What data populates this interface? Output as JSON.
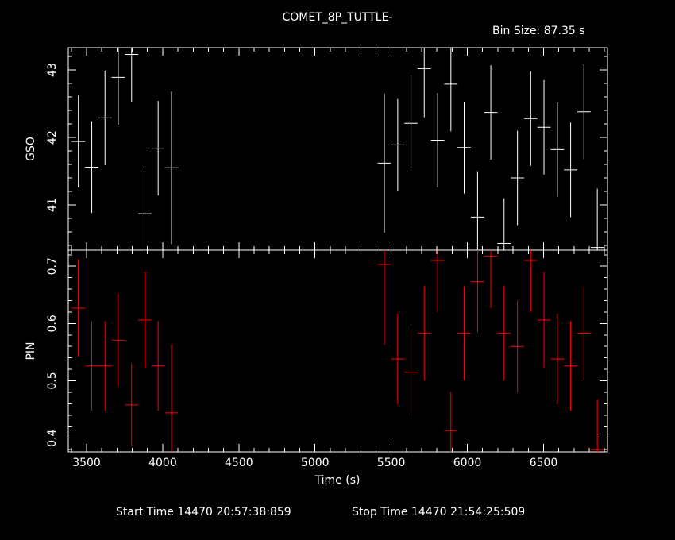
{
  "header": {
    "title": "COMET_8P_TUTTLE-",
    "bin_size": "Bin Size: 87.35 s"
  },
  "footer": {
    "start_time": "Start Time 14470 20:57:38:859",
    "stop_time": "Stop Time 14470 21:54:25:509"
  },
  "colors": {
    "gso": "#ffffff",
    "pin": "#ff0000",
    "axes": "#ffffff",
    "background": "#000000"
  },
  "chart_data": [
    {
      "type": "scatter",
      "panel": "top",
      "title": "",
      "xlabel": "",
      "ylabel": "GSO",
      "xlim": [
        3380,
        6920
      ],
      "ylim": [
        40.33,
        43.33
      ],
      "x_ticks": [
        3500,
        4000,
        4500,
        5000,
        5500,
        6000,
        6500
      ],
      "x_tick_labels": [],
      "y_ticks": [
        41,
        42,
        43
      ],
      "y_tick_labels": [
        "41",
        "42",
        "43"
      ],
      "x_half_width": 43.675,
      "series": [
        {
          "color": "#ffffff",
          "points": [
            {
              "x": 3446,
              "y": 41.94,
              "err": 0.68
            },
            {
              "x": 3534,
              "y": 41.56,
              "err": 0.68
            },
            {
              "x": 3621,
              "y": 42.29,
              "err": 0.7
            },
            {
              "x": 3708,
              "y": 42.89,
              "err": 0.7
            },
            {
              "x": 3796,
              "y": 43.23,
              "err": 0.7
            },
            {
              "x": 3883,
              "y": 40.87,
              "err": 0.67
            },
            {
              "x": 3970,
              "y": 41.84,
              "err": 0.7
            },
            {
              "x": 4058,
              "y": 41.55,
              "err": 1.13
            },
            {
              "x": 5455,
              "y": 41.62,
              "err": 1.03
            },
            {
              "x": 5543,
              "y": 41.89,
              "err": 0.68
            },
            {
              "x": 5630,
              "y": 42.21,
              "err": 0.7
            },
            {
              "x": 5717,
              "y": 43.02,
              "err": 0.72
            },
            {
              "x": 5805,
              "y": 41.96,
              "err": 0.7
            },
            {
              "x": 5892,
              "y": 42.79,
              "err": 0.7
            },
            {
              "x": 5979,
              "y": 41.85,
              "err": 0.68
            },
            {
              "x": 6067,
              "y": 40.82,
              "err": 0.68
            },
            {
              "x": 6154,
              "y": 42.37,
              "err": 0.7
            },
            {
              "x": 6241,
              "y": 40.43,
              "err": 0.67
            },
            {
              "x": 6329,
              "y": 41.4,
              "err": 0.7
            },
            {
              "x": 6416,
              "y": 42.28,
              "err": 0.7
            },
            {
              "x": 6503,
              "y": 42.15,
              "err": 0.7
            },
            {
              "x": 6591,
              "y": 41.82,
              "err": 0.7
            },
            {
              "x": 6678,
              "y": 41.52,
              "err": 0.7
            },
            {
              "x": 6765,
              "y": 42.38,
              "err": 0.7
            },
            {
              "x": 6853,
              "y": 40.37,
              "err": 0.87
            }
          ]
        }
      ]
    },
    {
      "type": "scatter",
      "panel": "bottom",
      "title": "",
      "xlabel": "Time (s)",
      "ylabel": "PIN",
      "xlim": [
        3380,
        6920
      ],
      "ylim": [
        0.376,
        0.728
      ],
      "x_ticks": [
        3500,
        4000,
        4500,
        5000,
        5500,
        6000,
        6500
      ],
      "x_tick_labels": [
        "3500",
        "4000",
        "4500",
        "5000",
        "5500",
        "6000",
        "6500"
      ],
      "y_ticks": [
        0.4,
        0.5,
        0.6,
        0.7
      ],
      "y_tick_labels": [
        "0.4",
        "0.5",
        "0.6",
        "0.7"
      ],
      "x_half_width": 43.675,
      "series": [
        {
          "color": "#ff0000",
          "points": [
            {
              "x": 3446,
              "y": 0.627,
              "err": 0.085
            },
            {
              "x": 3534,
              "y": 0.526,
              "err": 0.078
            },
            {
              "x": 3621,
              "y": 0.526,
              "err": 0.078
            },
            {
              "x": 3708,
              "y": 0.571,
              "err": 0.081
            },
            {
              "x": 3796,
              "y": 0.458,
              "err": 0.072
            },
            {
              "x": 3883,
              "y": 0.606,
              "err": 0.084
            },
            {
              "x": 3970,
              "y": 0.526,
              "err": 0.078
            },
            {
              "x": 4058,
              "y": 0.444,
              "err": 0.12
            },
            {
              "x": 5455,
              "y": 0.703,
              "err": 0.14
            },
            {
              "x": 5543,
              "y": 0.538,
              "err": 0.079
            },
            {
              "x": 5630,
              "y": 0.515,
              "err": 0.077
            },
            {
              "x": 5717,
              "y": 0.583,
              "err": 0.082
            },
            {
              "x": 5805,
              "y": 0.71,
              "err": 0.09
            },
            {
              "x": 5892,
              "y": 0.413,
              "err": 0.068
            },
            {
              "x": 5979,
              "y": 0.583,
              "err": 0.082
            },
            {
              "x": 6067,
              "y": 0.673,
              "err": 0.088
            },
            {
              "x": 6154,
              "y": 0.718,
              "err": 0.091
            },
            {
              "x": 6241,
              "y": 0.583,
              "err": 0.082
            },
            {
              "x": 6329,
              "y": 0.56,
              "err": 0.08
            },
            {
              "x": 6416,
              "y": 0.71,
              "err": 0.09
            },
            {
              "x": 6503,
              "y": 0.606,
              "err": 0.084
            },
            {
              "x": 6591,
              "y": 0.538,
              "err": 0.079
            },
            {
              "x": 6678,
              "y": 0.526,
              "err": 0.078
            },
            {
              "x": 6765,
              "y": 0.583,
              "err": 0.082
            },
            {
              "x": 6853,
              "y": 0.38,
              "err": 0.087
            }
          ]
        }
      ]
    }
  ]
}
